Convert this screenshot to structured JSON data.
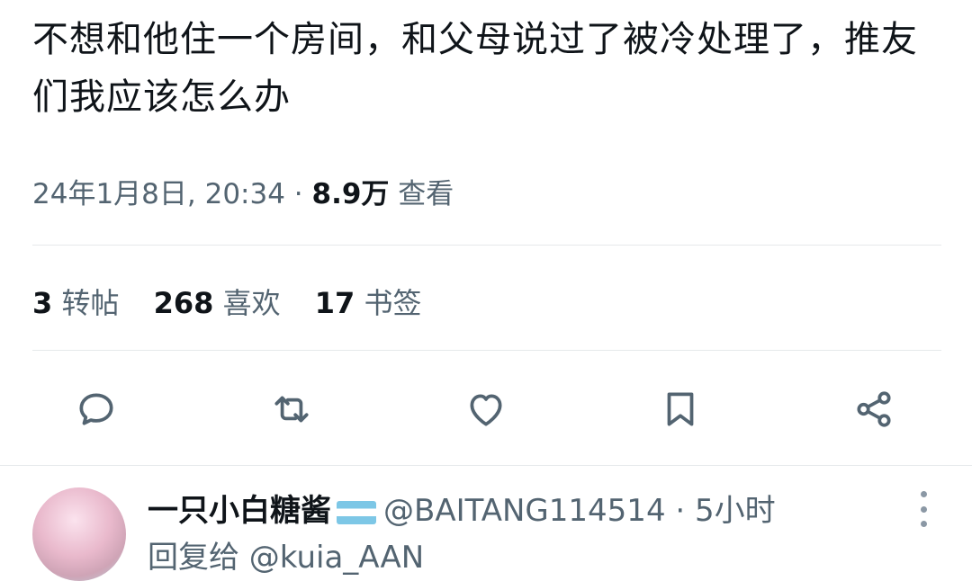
{
  "tweet": {
    "text": "不想和他住一个房间，和父母说过了被冷处理了，推友们我应该怎么办",
    "datetime": "24年1月8日, 20:34",
    "separator": " · ",
    "views_count": "8.9万",
    "views_label": " 查看"
  },
  "stats": {
    "retweets_count": "3",
    "retweets_label": "转帖",
    "likes_count": "268",
    "likes_label": "喜欢",
    "bookmarks_count": "17",
    "bookmarks_label": "书签"
  },
  "actions": [
    "reply-icon",
    "retweet-icon",
    "like-icon",
    "bookmark-icon",
    "share-icon"
  ],
  "reply": {
    "name": "一只小白糖酱",
    "handle": "@BAITANG114514",
    "separator": " · ",
    "time": "5小时",
    "reply_to_prefix": "回复给 @kuia_AAN"
  },
  "colors": {
    "text": "#0f1419",
    "secondary": "#536471",
    "icon": "#536471",
    "divider": "#e6e9eb"
  }
}
